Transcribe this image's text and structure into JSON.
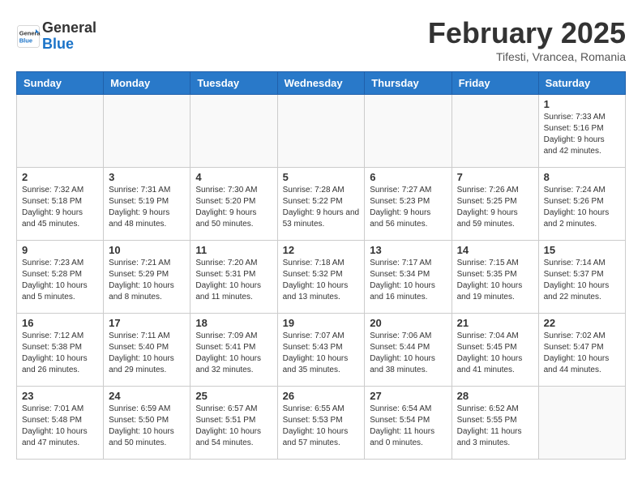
{
  "header": {
    "logo_general": "General",
    "logo_blue": "Blue",
    "month_title": "February 2025",
    "subtitle": "Tifesti, Vrancea, Romania"
  },
  "days_of_week": [
    "Sunday",
    "Monday",
    "Tuesday",
    "Wednesday",
    "Thursday",
    "Friday",
    "Saturday"
  ],
  "weeks": [
    [
      {
        "day": "",
        "info": ""
      },
      {
        "day": "",
        "info": ""
      },
      {
        "day": "",
        "info": ""
      },
      {
        "day": "",
        "info": ""
      },
      {
        "day": "",
        "info": ""
      },
      {
        "day": "",
        "info": ""
      },
      {
        "day": "1",
        "info": "Sunrise: 7:33 AM\nSunset: 5:16 PM\nDaylight: 9 hours and 42 minutes."
      }
    ],
    [
      {
        "day": "2",
        "info": "Sunrise: 7:32 AM\nSunset: 5:18 PM\nDaylight: 9 hours and 45 minutes."
      },
      {
        "day": "3",
        "info": "Sunrise: 7:31 AM\nSunset: 5:19 PM\nDaylight: 9 hours and 48 minutes."
      },
      {
        "day": "4",
        "info": "Sunrise: 7:30 AM\nSunset: 5:20 PM\nDaylight: 9 hours and 50 minutes."
      },
      {
        "day": "5",
        "info": "Sunrise: 7:28 AM\nSunset: 5:22 PM\nDaylight: 9 hours and 53 minutes."
      },
      {
        "day": "6",
        "info": "Sunrise: 7:27 AM\nSunset: 5:23 PM\nDaylight: 9 hours and 56 minutes."
      },
      {
        "day": "7",
        "info": "Sunrise: 7:26 AM\nSunset: 5:25 PM\nDaylight: 9 hours and 59 minutes."
      },
      {
        "day": "8",
        "info": "Sunrise: 7:24 AM\nSunset: 5:26 PM\nDaylight: 10 hours and 2 minutes."
      }
    ],
    [
      {
        "day": "9",
        "info": "Sunrise: 7:23 AM\nSunset: 5:28 PM\nDaylight: 10 hours and 5 minutes."
      },
      {
        "day": "10",
        "info": "Sunrise: 7:21 AM\nSunset: 5:29 PM\nDaylight: 10 hours and 8 minutes."
      },
      {
        "day": "11",
        "info": "Sunrise: 7:20 AM\nSunset: 5:31 PM\nDaylight: 10 hours and 11 minutes."
      },
      {
        "day": "12",
        "info": "Sunrise: 7:18 AM\nSunset: 5:32 PM\nDaylight: 10 hours and 13 minutes."
      },
      {
        "day": "13",
        "info": "Sunrise: 7:17 AM\nSunset: 5:34 PM\nDaylight: 10 hours and 16 minutes."
      },
      {
        "day": "14",
        "info": "Sunrise: 7:15 AM\nSunset: 5:35 PM\nDaylight: 10 hours and 19 minutes."
      },
      {
        "day": "15",
        "info": "Sunrise: 7:14 AM\nSunset: 5:37 PM\nDaylight: 10 hours and 22 minutes."
      }
    ],
    [
      {
        "day": "16",
        "info": "Sunrise: 7:12 AM\nSunset: 5:38 PM\nDaylight: 10 hours and 26 minutes."
      },
      {
        "day": "17",
        "info": "Sunrise: 7:11 AM\nSunset: 5:40 PM\nDaylight: 10 hours and 29 minutes."
      },
      {
        "day": "18",
        "info": "Sunrise: 7:09 AM\nSunset: 5:41 PM\nDaylight: 10 hours and 32 minutes."
      },
      {
        "day": "19",
        "info": "Sunrise: 7:07 AM\nSunset: 5:43 PM\nDaylight: 10 hours and 35 minutes."
      },
      {
        "day": "20",
        "info": "Sunrise: 7:06 AM\nSunset: 5:44 PM\nDaylight: 10 hours and 38 minutes."
      },
      {
        "day": "21",
        "info": "Sunrise: 7:04 AM\nSunset: 5:45 PM\nDaylight: 10 hours and 41 minutes."
      },
      {
        "day": "22",
        "info": "Sunrise: 7:02 AM\nSunset: 5:47 PM\nDaylight: 10 hours and 44 minutes."
      }
    ],
    [
      {
        "day": "23",
        "info": "Sunrise: 7:01 AM\nSunset: 5:48 PM\nDaylight: 10 hours and 47 minutes."
      },
      {
        "day": "24",
        "info": "Sunrise: 6:59 AM\nSunset: 5:50 PM\nDaylight: 10 hours and 50 minutes."
      },
      {
        "day": "25",
        "info": "Sunrise: 6:57 AM\nSunset: 5:51 PM\nDaylight: 10 hours and 54 minutes."
      },
      {
        "day": "26",
        "info": "Sunrise: 6:55 AM\nSunset: 5:53 PM\nDaylight: 10 hours and 57 minutes."
      },
      {
        "day": "27",
        "info": "Sunrise: 6:54 AM\nSunset: 5:54 PM\nDaylight: 11 hours and 0 minutes."
      },
      {
        "day": "28",
        "info": "Sunrise: 6:52 AM\nSunset: 5:55 PM\nDaylight: 11 hours and 3 minutes."
      },
      {
        "day": "",
        "info": ""
      }
    ]
  ]
}
